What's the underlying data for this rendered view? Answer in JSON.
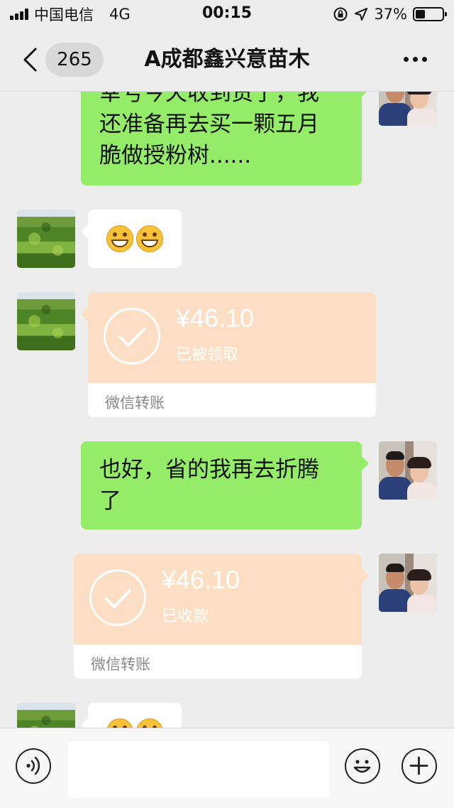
{
  "status_bar": {
    "carrier": "中国电信",
    "network": "4G",
    "time": "00:15",
    "battery_percent": "37%",
    "battery_level": 0.37
  },
  "nav": {
    "unread_count": "265",
    "title": "A成都鑫兴意苗木",
    "back_icon": "chevron-left-icon",
    "more_icon": "more-dots-icon"
  },
  "messages": [
    {
      "side": "right",
      "type": "text",
      "text_lines": [
        "幸亏今天收到货了，我",
        "还准备再去买一颗五月",
        "脆做授粉树......"
      ]
    },
    {
      "side": "left",
      "type": "emoji",
      "emoji": [
        "grin-emoji",
        "grin-emoji"
      ]
    },
    {
      "side": "left",
      "type": "transfer",
      "amount": "¥46.10",
      "status": "已被领取",
      "label": "微信转账"
    },
    {
      "side": "right",
      "type": "text",
      "text_lines": [
        "也好，省的我再去折腾",
        "了"
      ]
    },
    {
      "side": "right",
      "type": "transfer",
      "amount": "¥46.10",
      "status": "已收款",
      "label": "微信转账"
    },
    {
      "side": "left",
      "type": "emoji",
      "emoji": [
        "grin-emoji",
        "grin-emoji"
      ]
    }
  ],
  "input_bar": {
    "voice_icon": "voice-icon",
    "emoji_icon": "emoji-icon",
    "plus_icon": "plus-icon",
    "text_value": ""
  },
  "colors": {
    "background": "#ededed",
    "sent_bubble": "#95ec69",
    "received_bubble": "#ffffff",
    "transfer_bubble": "#fbdec3"
  }
}
